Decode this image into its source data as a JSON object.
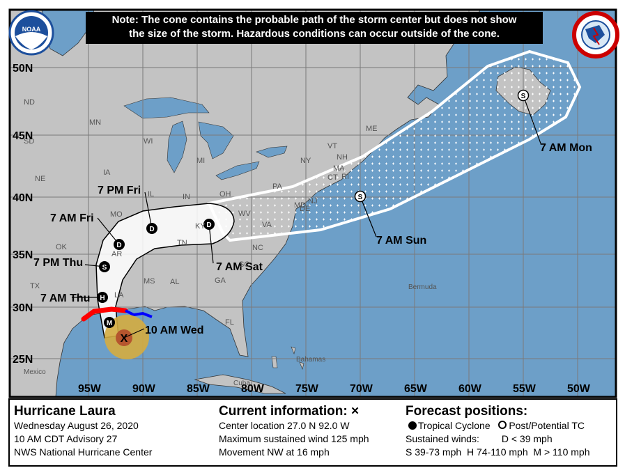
{
  "note": {
    "line1": "Note: The cone contains the probable path of the storm center but does not show",
    "line2": "the size of the storm. Hazardous conditions can occur outside of the cone."
  },
  "logos": {
    "left": "NOAA",
    "right": "NATIONAL WEATHER SERVICE"
  },
  "axes": {
    "latitudes": [
      "50N",
      "45N",
      "40N",
      "35N",
      "30N",
      "25N"
    ],
    "longitudes": [
      "95W",
      "90W",
      "85W",
      "80W",
      "75W",
      "70W",
      "65W",
      "60W",
      "55W",
      "50W"
    ]
  },
  "states": [
    "ND",
    "MN",
    "SD",
    "WI",
    "MI",
    "NY",
    "NE",
    "IA",
    "PA",
    "IL",
    "IN",
    "OH",
    "MO",
    "WV",
    "VA",
    "KY",
    "OK",
    "TN",
    "NC",
    "AR",
    "SC",
    "MS",
    "AL",
    "GA",
    "TX",
    "LA",
    "FL",
    "ME",
    "VT",
    "NH",
    "MA",
    "CT",
    "RI",
    "NJ",
    "MD",
    "DE"
  ],
  "places": [
    "Bermuda",
    "Bahamas",
    "Cuba",
    "Mexico"
  ],
  "track": [
    {
      "time": "10 AM Wed",
      "symbol": "X"
    },
    {
      "time": "",
      "symbol": "M"
    },
    {
      "time": "7 AM Thu",
      "symbol": "H"
    },
    {
      "time": "7 PM Thu",
      "symbol": "S"
    },
    {
      "time": "7 AM Fri",
      "symbol": "D"
    },
    {
      "time": "7 PM Fri",
      "symbol": "D"
    },
    {
      "time": "7 AM Sat",
      "symbol": "D"
    },
    {
      "time": "7 AM Sun",
      "symbol": "S"
    },
    {
      "time": "7 AM Mon",
      "symbol": "S"
    }
  ],
  "colors": {
    "ocean": "#6d9fc8",
    "land": "#c3c3c3",
    "hurricane_warning": "#ff0000",
    "tropical_storm_warning": "#0000ff",
    "hurricane_wind": "#b5552e",
    "ts_wind": "#d5ac3f"
  },
  "legend": {
    "storm": {
      "title": "Hurricane Laura",
      "date": "Wednesday August 26, 2020",
      "advisory": "10 AM CDT Advisory 27",
      "center": "NWS National Hurricane Center"
    },
    "current": {
      "title": "Current information: ×",
      "location": "Center location 27.0 N 92.0 W",
      "wind": "Maximum sustained wind 125 mph",
      "movement": "Movement NW at 16 mph"
    },
    "forecast": {
      "title": "Forecast positions:",
      "tc": "Tropical Cyclone",
      "ptc": "Post/Potential TC",
      "winds_label": "Sustained winds:",
      "d": "D < 39 mph",
      "s": "S 39-73 mph",
      "h": "H 74-110 mph",
      "m": "M > 110 mph"
    }
  }
}
